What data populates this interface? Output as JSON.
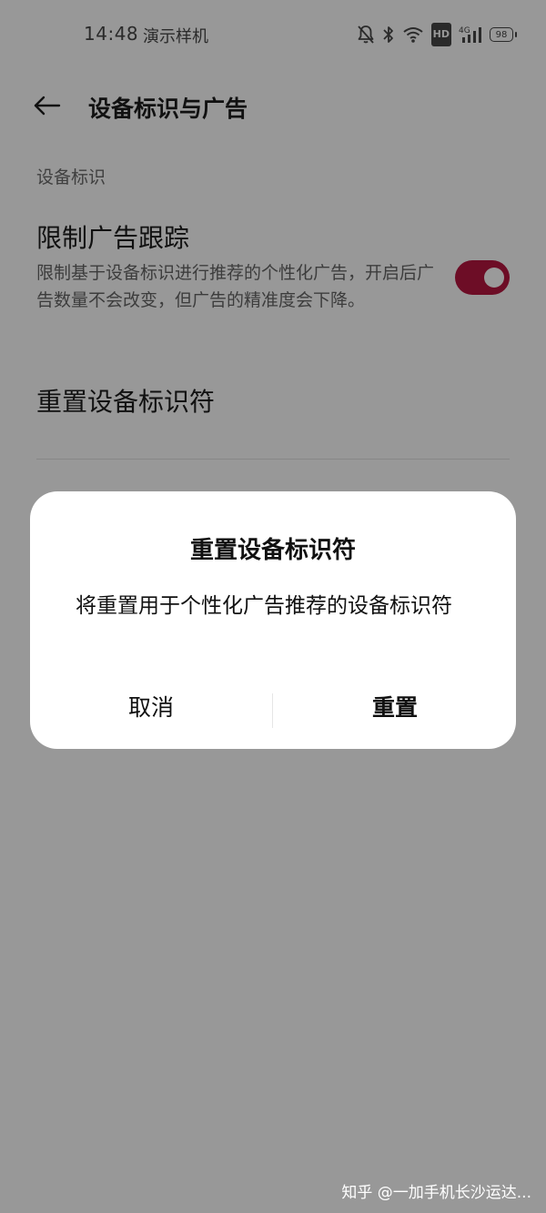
{
  "status_bar": {
    "time": "14:48",
    "carrier": "演示样机",
    "icons": [
      "bell-off-icon",
      "bluetooth-icon",
      "wifi-icon",
      "hd-badge",
      "cellular-signal-icon",
      "battery-icon"
    ],
    "hd_label": "HD",
    "network_label": "4G",
    "battery_level": "98"
  },
  "app_bar": {
    "back_icon": "arrow-left-icon",
    "title": "设备标识与广告"
  },
  "settings": {
    "section_header": "设备标识",
    "limit_ad_tracking": {
      "title": "限制广告跟踪",
      "description": "限制基于设备标识进行推荐的个性化广告，开启后广告数量不会改变，但广告的精准度会下降。",
      "enabled": true,
      "toggle_color": "#6d0d26"
    },
    "reset_identifier": {
      "title": "重置设备标识符"
    }
  },
  "dialog": {
    "title": "重置设备标识符",
    "message": "将重置用于个性化广告推荐的设备标识符",
    "cancel_label": "取消",
    "confirm_label": "重置"
  },
  "watermark": {
    "text": "知乎 @一加手机长沙运达..."
  },
  "colors": {
    "scrim_background": "#989898",
    "dialog_background": "#ffffff",
    "toggle_on": "#6d0d26"
  }
}
